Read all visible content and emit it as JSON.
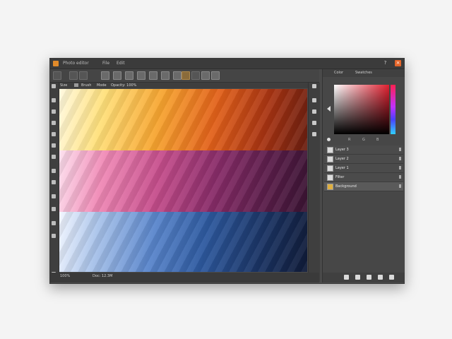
{
  "window": {
    "title": "Photo editor",
    "menu": [
      "File",
      "Edit"
    ],
    "win_buttons": [
      "?",
      "×"
    ],
    "colors": {
      "accent": "#e4652a",
      "panel": "#474747",
      "toolbar": "#454545"
    }
  },
  "toolbar": {
    "buttons": [
      "move-tool-icon",
      "lasso-icon",
      "crop-icon",
      "brush-icon",
      "stamp-icon",
      "eraser-icon",
      "gradient-icon",
      "blur-icon",
      "dodge-icon",
      "pen-icon",
      "text-icon",
      "shape-icon",
      "hand-icon",
      "zoom-icon",
      "star-icon",
      "layers-icon"
    ]
  },
  "options_bar": {
    "items": [
      "Size",
      "Brush",
      "Mode",
      "Opacity: 100%"
    ]
  },
  "status_bar": {
    "zoom": "100%",
    "doc": "Doc: 12.3M"
  },
  "panel": {
    "tabs": [
      "Color",
      "Swatches"
    ],
    "picker_labels": [
      "R",
      "G",
      "B"
    ],
    "layers": [
      {
        "name": "Layer 3",
        "icon": "layer-icon",
        "active": false
      },
      {
        "name": "Layer 2",
        "icon": "text-layer-icon",
        "active": false
      },
      {
        "name": "Layer 1",
        "icon": "folder-icon",
        "active": false
      },
      {
        "name": "Filter",
        "icon": "filter-icon",
        "active": false
      },
      {
        "name": "Background",
        "icon": "image-layer-icon",
        "active": true
      }
    ],
    "bottom_icons": [
      "link-icon",
      "fx-icon",
      "mask-icon",
      "adjustment-icon",
      "trash-icon"
    ]
  },
  "canvas": {
    "bands": [
      "warm-gradient",
      "magenta-gradient",
      "blue-gradient"
    ]
  }
}
